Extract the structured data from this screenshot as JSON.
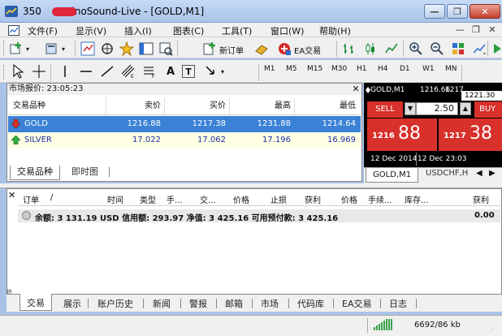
{
  "window": {
    "title_prefix": "350",
    "title": "SinoSound-Live - [GOLD,M1]",
    "min_glyph": "—",
    "max_glyph": "❐",
    "close_glyph": "✕"
  },
  "menu": {
    "items": [
      "文件(F)",
      "显示(V)",
      "插入(I)",
      "图表(C)",
      "工具(T)",
      "窗口(W)",
      "帮助(H)"
    ],
    "mdi_min": "—",
    "mdi_restore": "❐",
    "mdi_close": "✕"
  },
  "toolbar": {
    "new_order_label": "新订单",
    "ea_label": "EA交易",
    "timeframes": [
      "M1",
      "M5",
      "M15",
      "M30",
      "H1",
      "H4",
      "D1",
      "W1",
      "MN"
    ],
    "text_tool_a": "A",
    "text_tool_t": "T"
  },
  "market_watch": {
    "title": "市场报价: 23:05:23",
    "close_glyph": "✕",
    "headers": {
      "symbol": "交易品种",
      "bid": "卖价",
      "ask": "买价",
      "high": "最高",
      "low": "最低"
    },
    "rows": [
      {
        "symbol": "GOLD",
        "bid": "1216.88",
        "ask": "1217.38",
        "high": "1231.88",
        "low": "1214.64",
        "dir": "down"
      },
      {
        "symbol": "SILVER",
        "bid": "17.022",
        "ask": "17.062",
        "high": "17.196",
        "low": "16.969",
        "dir": "up"
      }
    ],
    "tabs": [
      "交易品种",
      "即时图"
    ]
  },
  "one_click": {
    "symbol": "GOLD,M1",
    "bid_price": "1216.66",
    "ask_price": "1217",
    "ask_box": "1221.30",
    "sell_label": "SELL",
    "buy_label": "BUY",
    "lot": "2.50",
    "bid_small": "1216",
    "bid_big": "88",
    "ask_small": "1217",
    "ask_big": "38",
    "date_left": "12 Dec 2014",
    "date_right": "12 Dec 23:03"
  },
  "chart_tabs": {
    "tabs": [
      "GOLD,M1",
      "USDCHF,H"
    ]
  },
  "terminal": {
    "close_glyph": "✕",
    "headers": [
      "订单",
      "/",
      "时间",
      "类型",
      "手...",
      "交...",
      "价格",
      "止损",
      "获利",
      "价格",
      "手续...",
      "库存...",
      "获利"
    ],
    "balance_text": "余额: 3 131.19 USD  信用额: 293.97  净值: 3 425.16  可用预付款: 3 425.16",
    "balance_profit": "0.00",
    "side_label": "终端",
    "tabs": [
      "交易",
      "展示",
      "账户历史",
      "新闻",
      "警报",
      "邮箱",
      "市场",
      "代码库",
      "EA交易",
      "日志"
    ]
  },
  "status": {
    "traffic": "6692/86 kb"
  },
  "colors": {
    "sell_red": "#d8302a",
    "selected_row": "#3a82d6",
    "silver_row": "#ffffe3"
  }
}
